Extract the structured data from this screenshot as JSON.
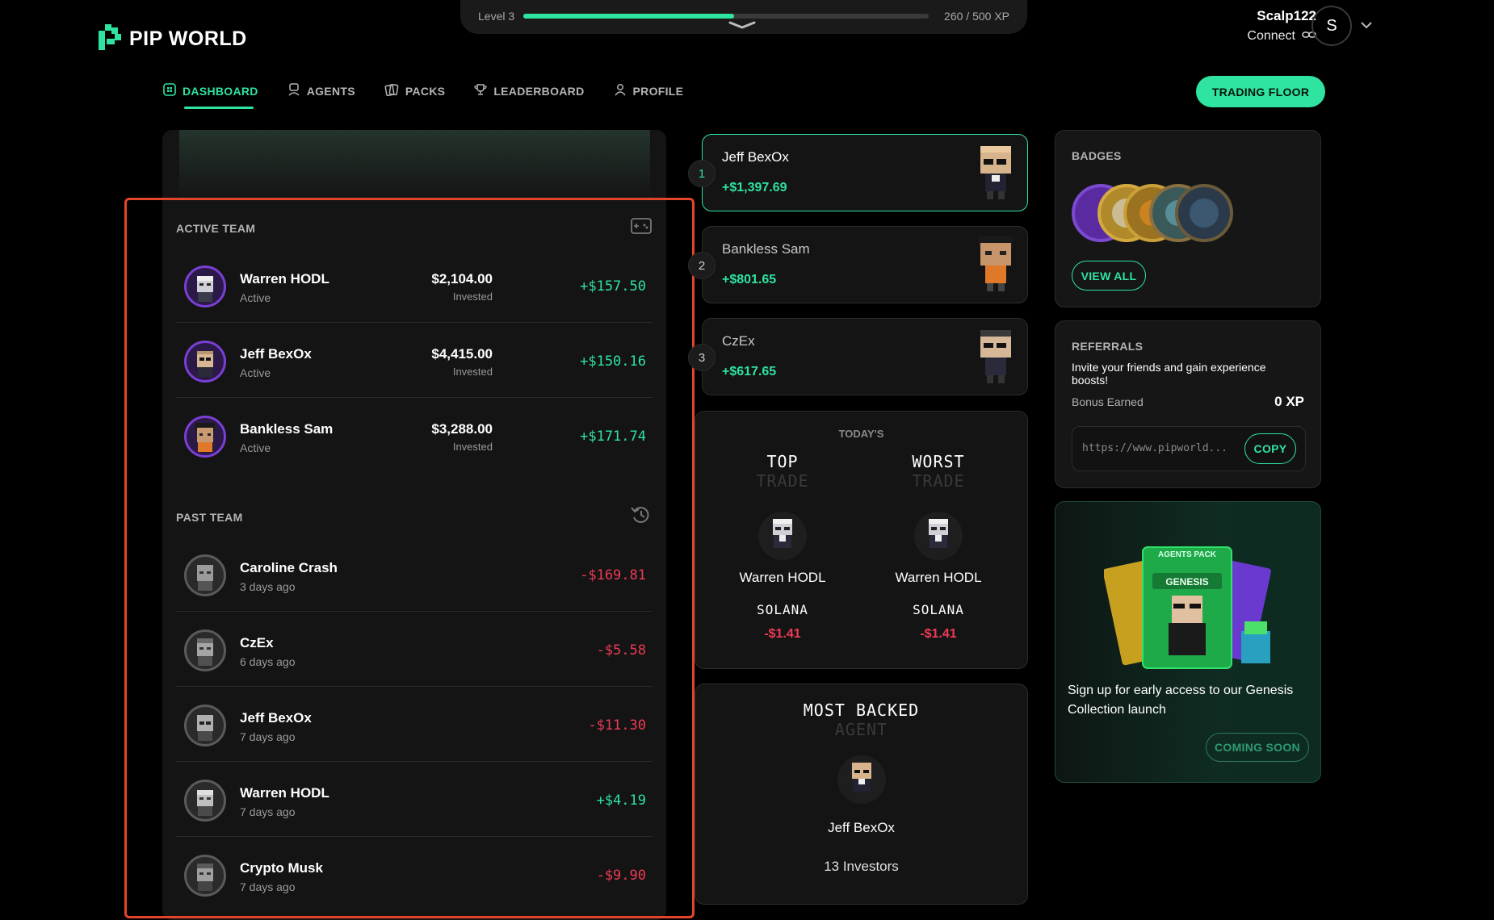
{
  "level": {
    "label": "Level 3",
    "xp_text": "260 / 500 XP",
    "progress": 0.52
  },
  "brand": {
    "name": "PIP WORLD",
    "accent": "#2fe3a0"
  },
  "user": {
    "name": "Scalp122",
    "connect_label": "Connect",
    "avatar_letter": "S"
  },
  "nav": {
    "items": [
      {
        "label": "DASHBOARD",
        "icon": "dashboard-icon",
        "active": true
      },
      {
        "label": "AGENTS",
        "icon": "agents-icon",
        "active": false
      },
      {
        "label": "PACKS",
        "icon": "packs-icon",
        "active": false
      },
      {
        "label": "LEADERBOARD",
        "icon": "trophy-icon",
        "active": false
      },
      {
        "label": "PROFILE",
        "icon": "profile-icon",
        "active": false
      }
    ],
    "cta_label": "TRADING FLOOR"
  },
  "active_team": {
    "title": "ACTIVE TEAM",
    "members": [
      {
        "name": "Warren HODL",
        "status": "Active",
        "amount": "$2,104.00",
        "amount_label": "Invested",
        "pnl": "+$157.50"
      },
      {
        "name": "Jeff BexOx",
        "status": "Active",
        "amount": "$4,415.00",
        "amount_label": "Invested",
        "pnl": "+$150.16"
      },
      {
        "name": "Bankless Sam",
        "status": "Active",
        "amount": "$3,288.00",
        "amount_label": "Invested",
        "pnl": "+$171.74"
      }
    ]
  },
  "past_team": {
    "title": "PAST TEAM",
    "members": [
      {
        "name": "Caroline Crash",
        "time": "3 days ago",
        "pnl": "-$169.81"
      },
      {
        "name": "CzEx",
        "time": "6 days ago",
        "pnl": "-$5.58"
      },
      {
        "name": "Jeff BexOx",
        "time": "7 days ago",
        "pnl": "-$11.30"
      },
      {
        "name": "Warren HODL",
        "time": "7 days ago",
        "pnl": "+$4.19"
      },
      {
        "name": "Crypto Musk",
        "time": "7 days ago",
        "pnl": "-$9.90"
      }
    ]
  },
  "leaderboard": [
    {
      "rank": "1",
      "name": "Jeff BexOx",
      "value": "+$1,397.69"
    },
    {
      "rank": "2",
      "name": "Bankless Sam",
      "value": "+$801.65"
    },
    {
      "rank": "3",
      "name": "CzEx",
      "value": "+$617.65"
    }
  ],
  "todays": {
    "heading": "TODAY'S",
    "top": {
      "title": "TOP",
      "subtitle": "TRADE",
      "agent": "Warren HODL",
      "chain": "SOLANA",
      "value": "-$1.41"
    },
    "worst": {
      "title": "WORST",
      "subtitle": "TRADE",
      "agent": "Warren HODL",
      "chain": "SOLANA",
      "value": "-$1.41"
    }
  },
  "most_backed": {
    "title": "MOST BACKED",
    "subtitle": "AGENT",
    "agent": "Jeff BexOx",
    "investors": "13 Investors"
  },
  "badges": {
    "title": "BADGES",
    "view_all": "VIEW ALL"
  },
  "referrals": {
    "title": "REFERRALS",
    "description": "Invite your friends and gain experience boosts!",
    "bonus_label": "Bonus Earned",
    "bonus_value": "0 XP",
    "link": "https://www.pipworld...",
    "copy_label": "COPY"
  },
  "promo": {
    "pack_title": "AGENTS PACK",
    "pack_subtitle": "GENESIS",
    "text": "Sign up for early access to our Genesis Collection launch",
    "button": "COMING SOON"
  }
}
